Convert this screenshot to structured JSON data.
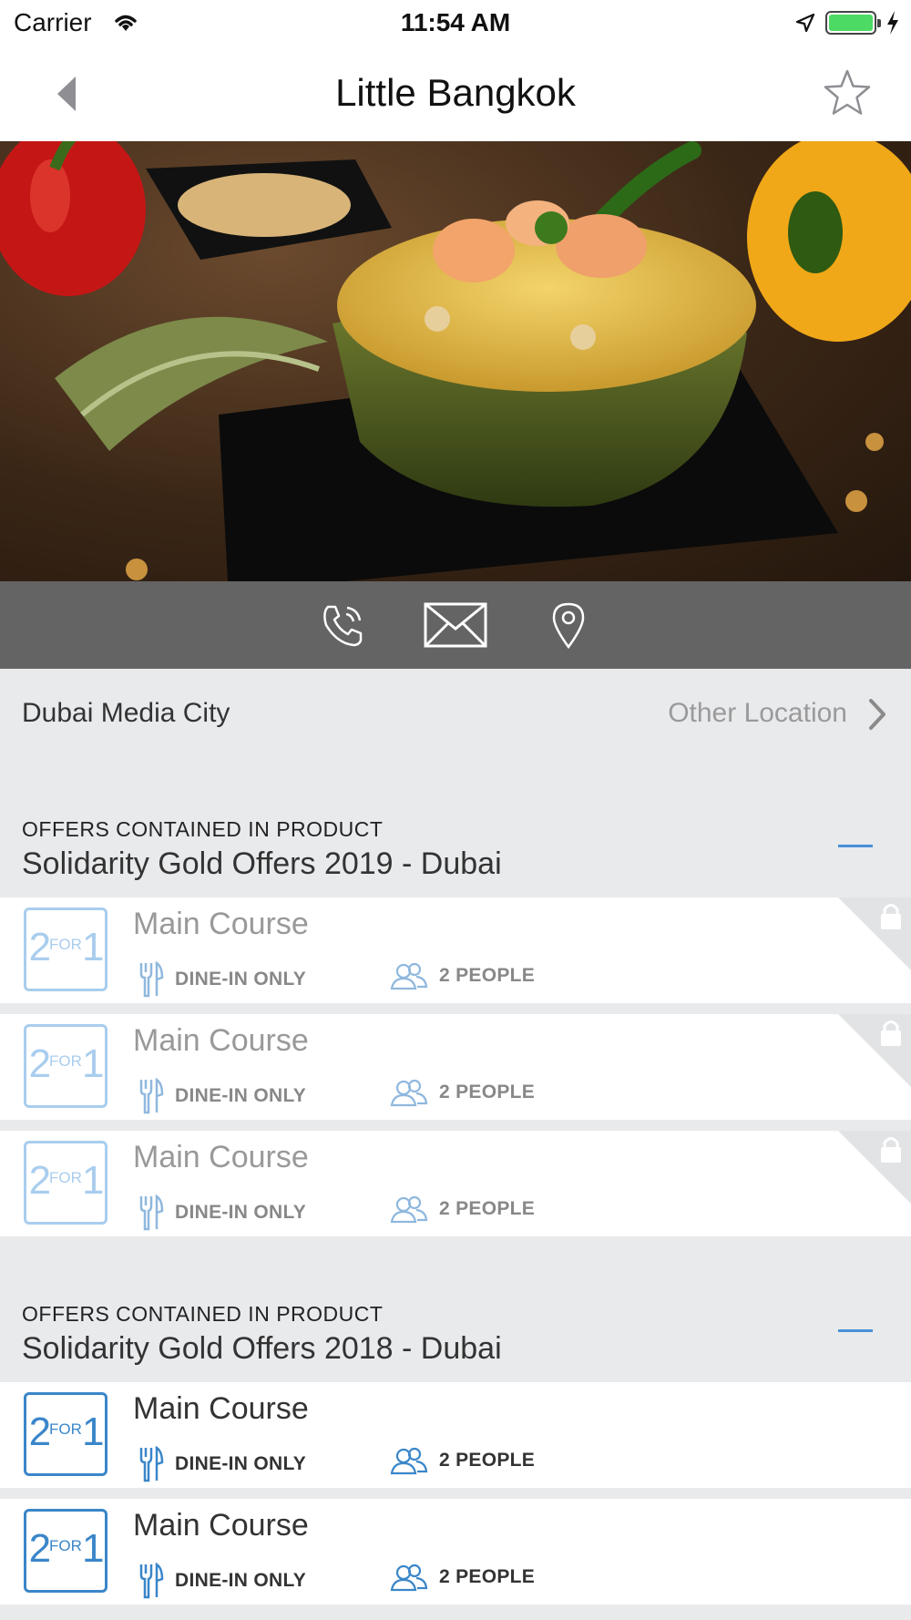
{
  "status_bar": {
    "carrier": "Carrier",
    "time": "11:54 AM"
  },
  "nav": {
    "title": "Little Bangkok",
    "back_icon": "chevron-left-icon",
    "favorite_icon": "star-outline-icon"
  },
  "hero": {
    "image": "pineapple-fried-rice-photo",
    "slides": 3,
    "active_slide": 1
  },
  "actions": [
    {
      "name": "phone-icon"
    },
    {
      "name": "mail-icon"
    },
    {
      "name": "map-pin-icon"
    }
  ],
  "location": {
    "name": "Dubai Media City",
    "other_label": "Other Location"
  },
  "sections": [
    {
      "caption": "OFFERS CONTAINED IN PRODUCT",
      "title": "Solidarity Gold Offers 2019 - Dubai",
      "locked": true,
      "offers": [
        {
          "badge_big": "2",
          "badge_small": "FOR",
          "badge_end": "1",
          "title": "Main Course",
          "type": "DINE-IN ONLY",
          "people": "2 PEOPLE"
        },
        {
          "badge_big": "2",
          "badge_small": "FOR",
          "badge_end": "1",
          "title": "Main Course",
          "type": "DINE-IN ONLY",
          "people": "2 PEOPLE"
        },
        {
          "badge_big": "2",
          "badge_small": "FOR",
          "badge_end": "1",
          "title": "Main Course",
          "type": "DINE-IN ONLY",
          "people": "2 PEOPLE"
        }
      ]
    },
    {
      "caption": "OFFERS CONTAINED IN PRODUCT",
      "title": "Solidarity Gold Offers 2018 - Dubai",
      "locked": false,
      "offers": [
        {
          "badge_big": "2",
          "badge_small": "FOR",
          "badge_end": "1",
          "title": "Main Course",
          "type": "DINE-IN ONLY",
          "people": "2 PEOPLE"
        },
        {
          "badge_big": "2",
          "badge_small": "FOR",
          "badge_end": "1",
          "title": "Main Course",
          "type": "DINE-IN ONLY",
          "people": "2 PEOPLE"
        }
      ]
    }
  ],
  "colors": {
    "accent": "#3a86c9",
    "accent_light": "#a9cdee",
    "action_bar": "#646464",
    "background": "#e9eaec"
  }
}
